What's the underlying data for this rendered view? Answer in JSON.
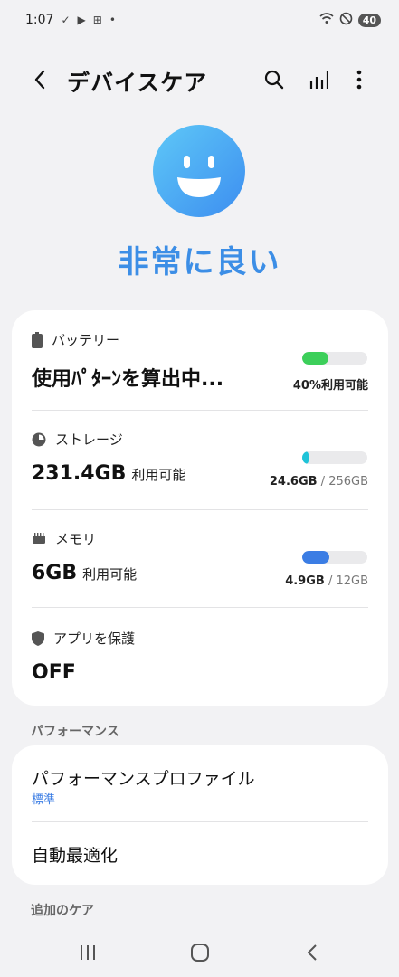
{
  "status_bar": {
    "time": "1:07",
    "battery": "40",
    "icons": [
      "check-icon",
      "play-store-icon",
      "plus-box-icon",
      "dot-icon",
      "wifi-icon",
      "do-not-disturb-icon"
    ]
  },
  "app_bar": {
    "title": "デバイスケア",
    "icons": [
      "back-icon",
      "search-icon",
      "stats-icon",
      "more-icon"
    ]
  },
  "hero": {
    "status": "非常に良い",
    "face_color": "#3d8ef0",
    "status_color": "#3c8ee6"
  },
  "status_items": [
    {
      "label": "バッテリー",
      "icon": "battery-icon",
      "value": "使用ﾊﾟﾀｰﾝを算出中...",
      "sub": "",
      "bar_percent": 40,
      "bar_color": "#3ccf5a",
      "right_main": "40%利用可能",
      "right_muted": ""
    },
    {
      "label": "ストレージ",
      "icon": "storage-pie-icon",
      "value": "231.4GB",
      "sub": "利用可能",
      "bar_percent": 10,
      "bar_color": "#1fc3d8",
      "right_main": "24.6GB",
      "right_muted": " / 256GB"
    },
    {
      "label": "メモリ",
      "icon": "memory-chip-icon",
      "value": "6GB",
      "sub": "利用可能",
      "bar_percent": 41,
      "bar_color": "#3b7de4",
      "right_main": "4.9GB",
      "right_muted": " / 12GB"
    },
    {
      "label": "アプリを保護",
      "icon": "shield-icon",
      "value": "OFF",
      "sub": ""
    }
  ],
  "performance": {
    "header": "パフォーマンス",
    "profile_label": "パフォーマンスプロファイル",
    "profile_value": "標準",
    "auto_optimize_label": "自動最適化"
  },
  "additional_care": {
    "header": "追加のケア"
  },
  "nav_bar": {
    "icons": [
      "recents-icon",
      "home-icon",
      "back-nav-icon"
    ]
  }
}
